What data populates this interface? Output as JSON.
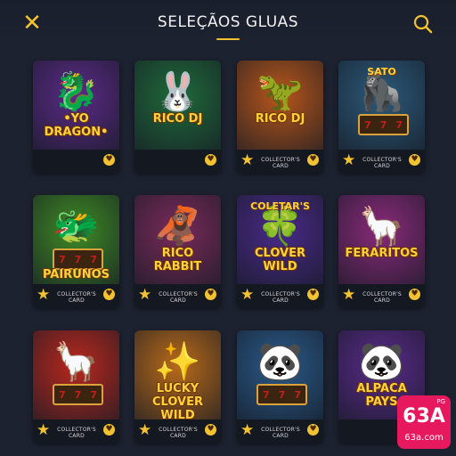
{
  "header": {
    "title": "SELEÇÃOS GLUAS",
    "close_icon": "close-icon",
    "search_icon": "search-icon",
    "accent_color": "#f2c230"
  },
  "games": [
    {
      "name": "•YO DRAGON•",
      "tagline": "",
      "emoji": "🐉",
      "badge": "",
      "bg": "#5b2a86"
    },
    {
      "name": "RICO DJ",
      "tagline": "",
      "emoji": "🐰",
      "badge": "",
      "bg": "#1f6a3a"
    },
    {
      "name": "RICO DJ",
      "tagline": "",
      "emoji": "🦖",
      "badge": "COLLECTOR'S CARD",
      "bg": "#b8561a"
    },
    {
      "name": "",
      "tagline": "SATO",
      "emoji": "🦍",
      "badge": "COLLECTOR'S CARD",
      "bg": "#2c5a7a",
      "reels": true
    },
    {
      "name": "PAIRUNOS",
      "tagline": "",
      "emoji": "🐲",
      "badge": "COLLECTOR'S CARD",
      "bg": "#3f8a24",
      "reels": true
    },
    {
      "name": "RICO RABBIT",
      "tagline": "",
      "emoji": "🦧",
      "badge": "COLLECTOR'S CARD",
      "bg": "#7a2a5a"
    },
    {
      "name": "CLOVER WILD",
      "tagline": "COLETAR'S",
      "emoji": "🍀",
      "badge": "COLLECTOR'S CARD",
      "bg": "#4a2a8a"
    },
    {
      "name": "FERARITOS",
      "tagline": "",
      "emoji": "🦙",
      "badge": "COLLECTOR'S CARD",
      "bg": "#8a2a7a"
    },
    {
      "name": "",
      "tagline": "",
      "emoji": "🦙",
      "badge": "COLLECTOR'S CARD",
      "bg": "#b8281e",
      "reels": true
    },
    {
      "name": "LUCKY CLOVER WILD",
      "tagline": "",
      "emoji": "✨",
      "badge": "COLLECTOR'S CARD",
      "bg": "#b86a1a"
    },
    {
      "name": "",
      "tagline": "",
      "emoji": "🐼",
      "badge": "COLLECTOR'S CARD",
      "bg": "#2a5a8a",
      "reels": true
    },
    {
      "name": "ALPACA PAYS",
      "tagline": "",
      "emoji": "🐼",
      "badge": "",
      "bg": "#5a2a8a"
    }
  ],
  "watermark": {
    "small": "PG",
    "big": "63A",
    "domain": "63a.com"
  }
}
